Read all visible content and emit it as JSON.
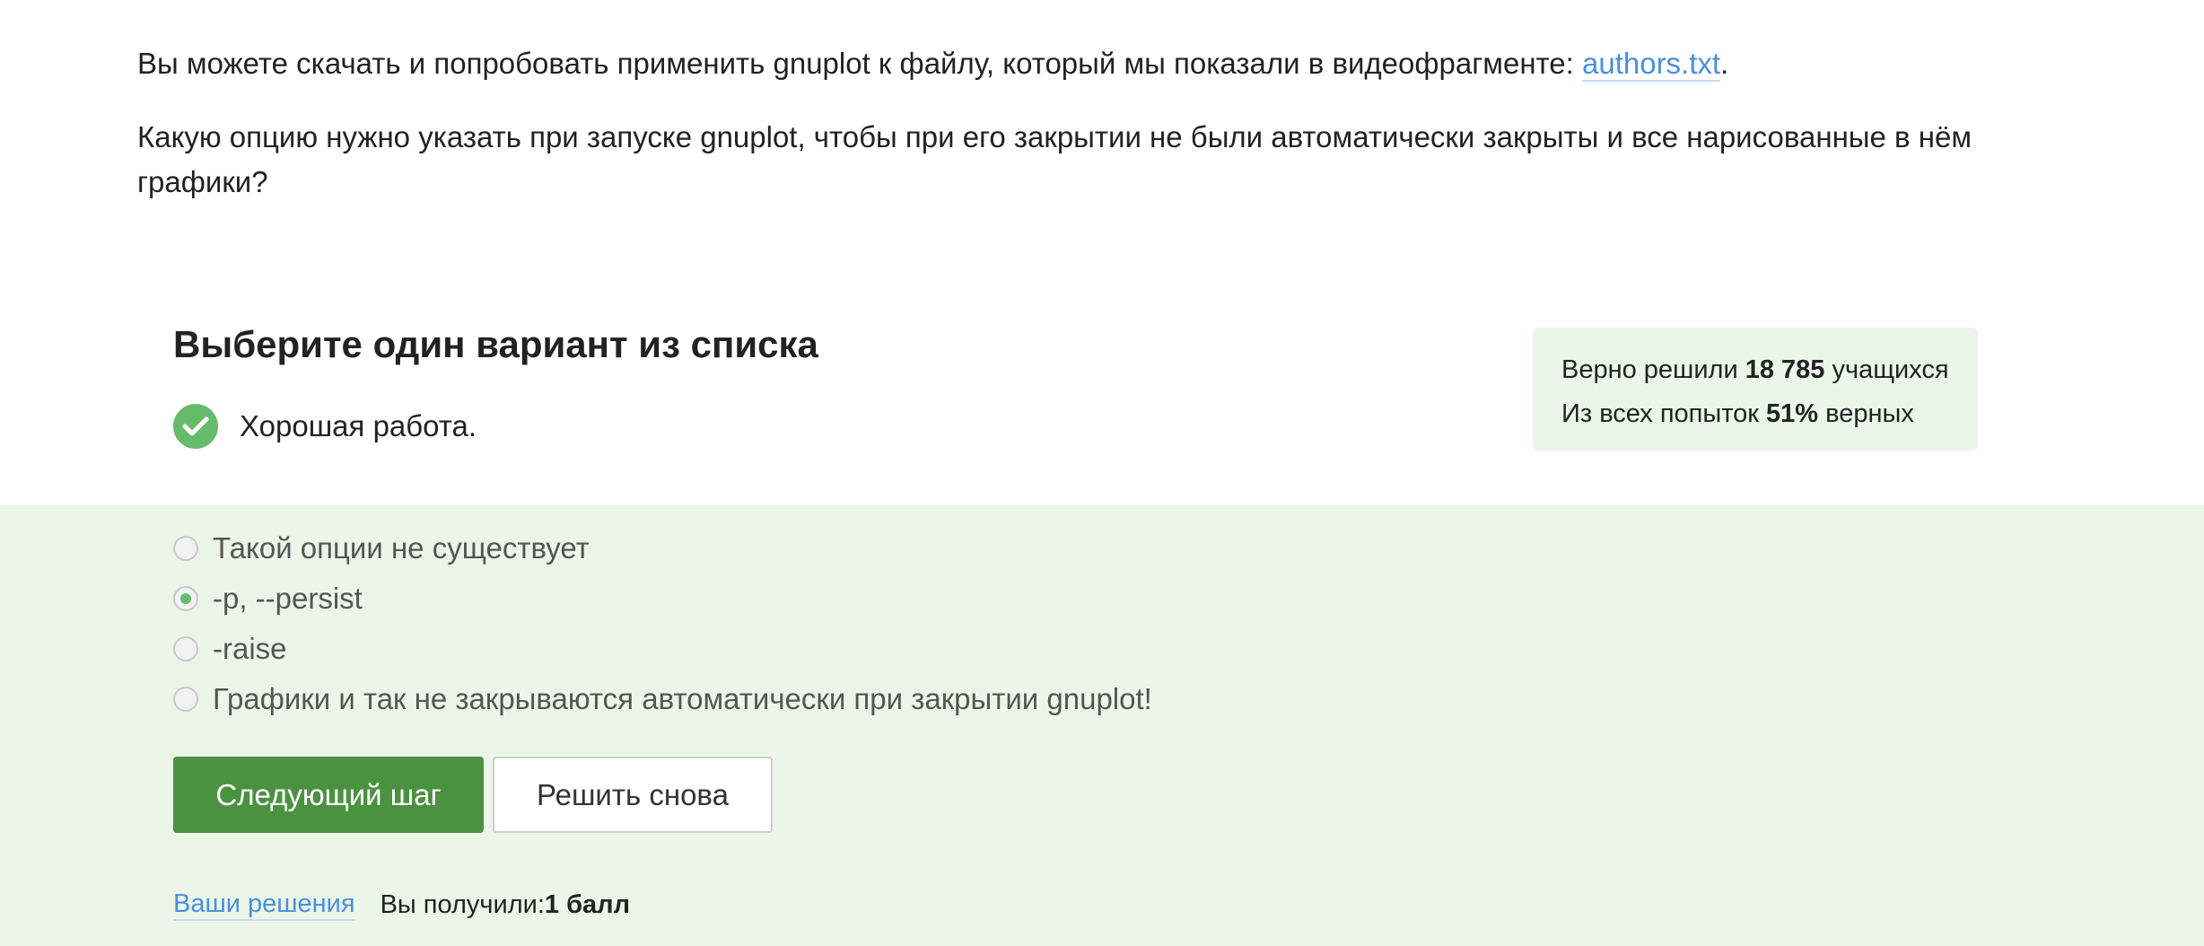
{
  "intro": {
    "line1_text": "Вы можете скачать и попробовать применить gnuplot к файлу, который мы показали в видеофрагменте: ",
    "line1_link": "authors.txt",
    "line1_end": ".",
    "question": "Какую опцию нужно указать при запуске gnuplot, чтобы при его закрытии не были автоматически закрыты и все нарисованные в нём графики?"
  },
  "quiz": {
    "header": "Выберите один вариант из списка",
    "feedback": "Хорошая работа."
  },
  "stats": {
    "solved_prefix": "Верно решили ",
    "solved_count": "18 785",
    "solved_suffix": " учащихся",
    "attempts_prefix": "Из всех попыток ",
    "attempts_percent": "51%",
    "attempts_suffix": " верных"
  },
  "options": [
    {
      "label": "Такой опции не существует",
      "selected": false
    },
    {
      "label": "-p, --persist",
      "selected": true
    },
    {
      "label": "-raise",
      "selected": false
    },
    {
      "label": "Графики и так не закрываются автоматически при закрытии gnuplot!",
      "selected": false
    }
  ],
  "buttons": {
    "next": "Следующий шаг",
    "retry": "Решить снова"
  },
  "footer": {
    "solutions_link": "Ваши решения",
    "score_label": "Вы получили: ",
    "score_value": "1 балл"
  },
  "colors": {
    "accent_green": "#4b9240",
    "check_green": "#66bb6a",
    "panel_bg": "#ebf6e9",
    "link_blue": "#4a8fdc"
  }
}
